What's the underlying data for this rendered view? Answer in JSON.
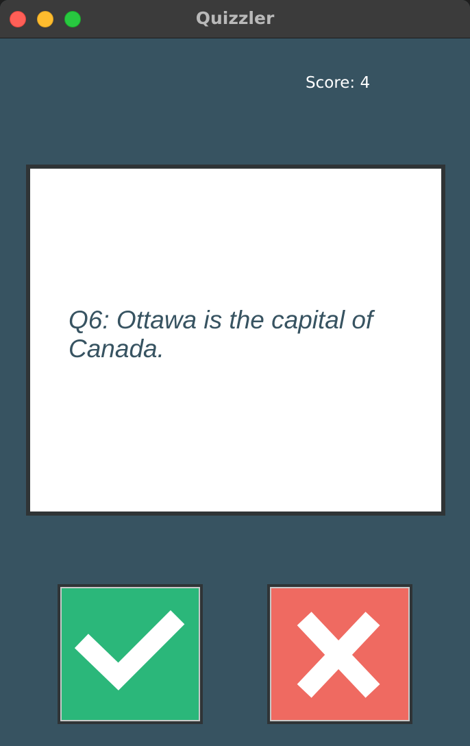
{
  "window": {
    "title": "Quizzler"
  },
  "score": {
    "text": "Score: 4"
  },
  "question": {
    "text": "Q6: Ottawa is the capital of Canada."
  },
  "buttons": {
    "true_icon": "check-icon",
    "false_icon": "x-mark-icon"
  },
  "colors": {
    "background": "#375361",
    "card": "#ffffff",
    "question_text": "#375361",
    "true_button": "#2bb77a",
    "false_button": "#ef6a61"
  }
}
